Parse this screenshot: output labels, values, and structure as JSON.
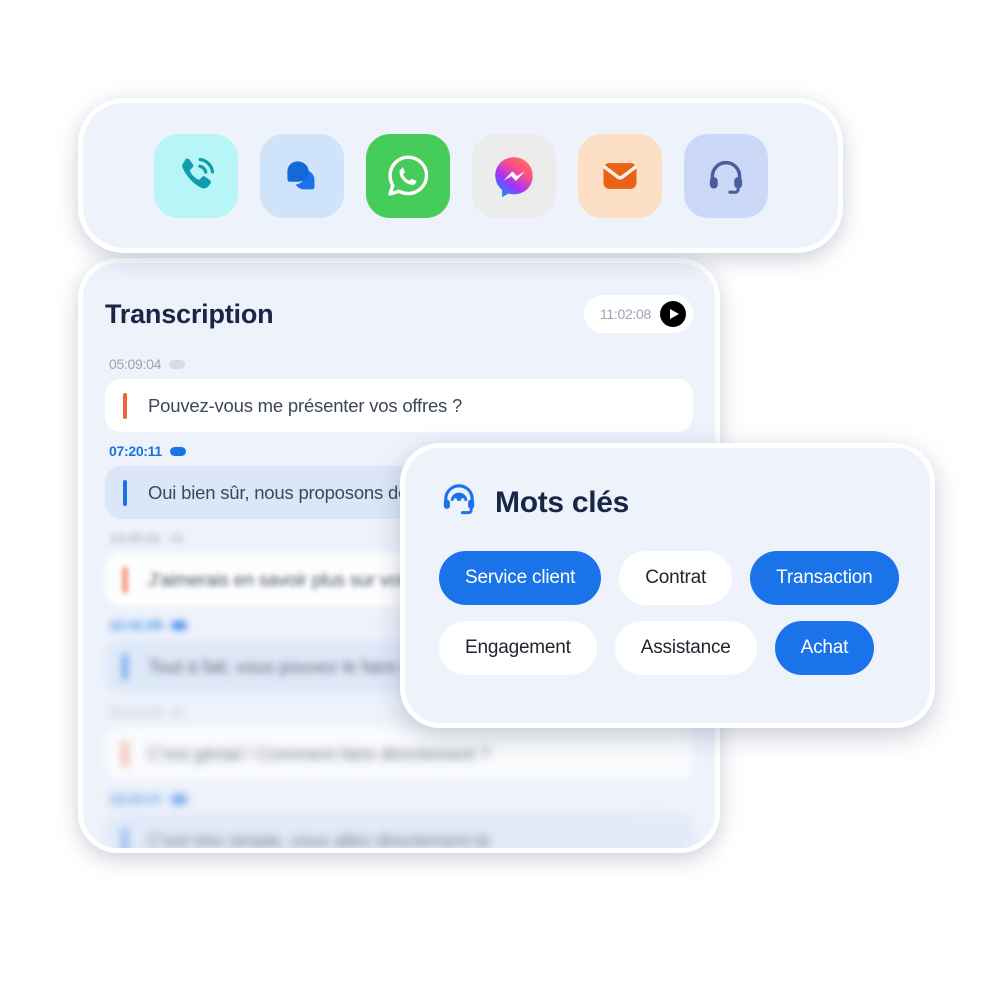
{
  "channels": {
    "items": [
      {
        "name": "phone-call",
        "icon": "phone-ringing-icon",
        "tile_bg": "#b8f5f7",
        "fg": "#0f9eb0"
      },
      {
        "name": "live-chat",
        "icon": "chat-bubbles-icon",
        "tile_bg": "#cfe4fb",
        "fg": "#1a73e8"
      },
      {
        "name": "whatsapp",
        "icon": "whatsapp-icon",
        "tile_bg": "#46cc5b",
        "fg": "#ffffff"
      },
      {
        "name": "messenger",
        "icon": "messenger-icon",
        "tile_bg": "#ececec",
        "fg": "#ffffff"
      },
      {
        "name": "email",
        "icon": "envelope-icon",
        "tile_bg": "#fcdfc4",
        "fg": "#ea6118"
      },
      {
        "name": "support",
        "icon": "headset-icon",
        "tile_bg": "#ccd8f8",
        "fg": "#4a5d9c"
      }
    ]
  },
  "transcription": {
    "title": "Transcription",
    "timer": "11:02:08",
    "play_label": "play-icon",
    "messages": [
      {
        "time": "05:09:04",
        "speaker": "agent",
        "text": "Pouvez-vous me présenter vos offres ?",
        "blur": ""
      },
      {
        "time": "07:20:11",
        "speaker": "client",
        "text": "Oui bien sûr, nous proposons des solutions adaptées",
        "blur": ""
      },
      {
        "time": "10:05:01",
        "speaker": "agent",
        "text": "J'aimerais en savoir plus sur votre service client",
        "blur": "blur1"
      },
      {
        "time": "12:41:09",
        "speaker": "client",
        "text": "Tout à fait, vous pouvez le faire en quelques clics",
        "blur": "blur2"
      },
      {
        "time": "15:12:33",
        "speaker": "agent",
        "text": "C'est génial ! Comment faire directement ?",
        "blur": "blur3"
      },
      {
        "time": "18:03:47",
        "speaker": "client",
        "text": "C'est très simple, vous allez directement là",
        "blur": "blur3"
      }
    ]
  },
  "keywords": {
    "title": "Mots clés",
    "icon": "headset-support-icon",
    "rows": [
      [
        {
          "label": "Service client",
          "selected": true
        },
        {
          "label": "Contrat",
          "selected": false
        },
        {
          "label": "Transaction",
          "selected": true
        }
      ],
      [
        {
          "label": "Engagement",
          "selected": false
        },
        {
          "label": "Assistance",
          "selected": false
        },
        {
          "label": "Achat",
          "selected": true
        }
      ]
    ]
  },
  "colors": {
    "accent_blue": "#1a73e8",
    "accent_orange": "#f2653a",
    "panel_bg": "#eef2fb",
    "title": "#182746"
  }
}
